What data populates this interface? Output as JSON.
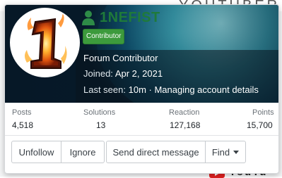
{
  "background": {
    "top_text": "YOUTUBER",
    "bottom_text": "YouTu"
  },
  "profile": {
    "username": "1NEFIST",
    "badge": "Contributor",
    "title": "Forum Contributor",
    "joined_label": "Joined:",
    "joined_value": "Apr 2, 2021",
    "last_seen_label": "Last seen:",
    "last_seen_value": "10m · Managing account details",
    "avatar_glyph": "1",
    "colors": {
      "username": "#1f7a3a",
      "badge": "#3c9a3c"
    }
  },
  "stats": [
    {
      "label": "Posts",
      "value": "4,518"
    },
    {
      "label": "Solutions",
      "value": "13"
    },
    {
      "label": "Reaction",
      "value": "127,168"
    },
    {
      "label": "Points",
      "value": "15,700"
    }
  ],
  "actions": {
    "unfollow": "Unfollow",
    "ignore": "Ignore",
    "send_message": "Send direct message",
    "find": "Find"
  }
}
